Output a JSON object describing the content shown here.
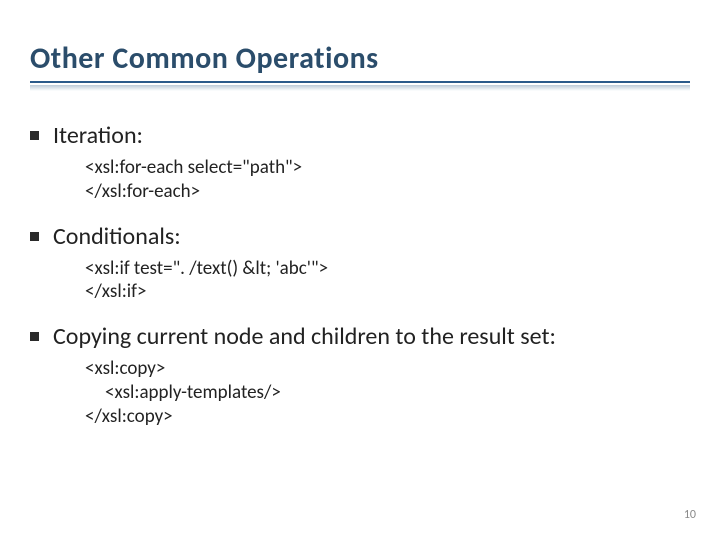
{
  "title": "Other Common Operations",
  "sections": [
    {
      "heading": "Iteration:",
      "code": [
        {
          "text": "<xsl:for-each select=\"path\">",
          "indent": false
        },
        {
          "text": "</xsl:for-each>",
          "indent": false
        }
      ]
    },
    {
      "heading": "Conditionals:",
      "code": [
        {
          "text": "<xsl:if test=\". /text() &lt; 'abc'\">",
          "indent": false
        },
        {
          "text": "</xsl:if>",
          "indent": false
        }
      ]
    },
    {
      "heading": "Copying current node and children to the result set:",
      "code": [
        {
          "text": "<xsl:copy>",
          "indent": false
        },
        {
          "text": "<xsl:apply-templates/>",
          "indent": true
        },
        {
          "text": "</xsl:copy>",
          "indent": false
        }
      ]
    }
  ],
  "page_number": "10"
}
